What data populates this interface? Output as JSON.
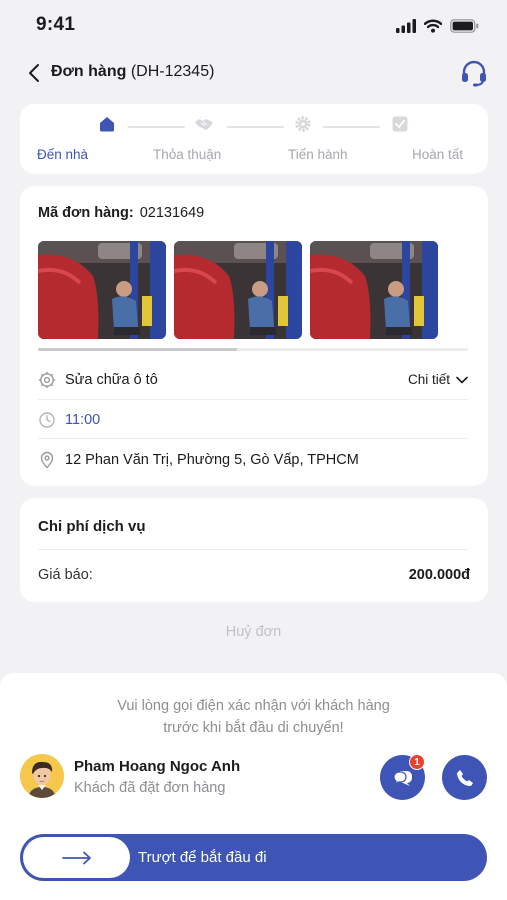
{
  "status_bar": {
    "time": "9:41"
  },
  "header": {
    "title": "Đơn hàng",
    "order_ref": "(DH-12345)"
  },
  "steps": [
    {
      "label": "Đến nhà",
      "active": true,
      "icon": "house-icon"
    },
    {
      "label": "Thỏa thuận",
      "active": false,
      "icon": "handshake-icon"
    },
    {
      "label": "Tiến hành",
      "active": false,
      "icon": "gear-icon"
    },
    {
      "label": "Hoàn tất",
      "active": false,
      "icon": "checkbox-icon"
    }
  ],
  "order": {
    "code_label": "Mã đơn hàng:",
    "code_value": "02131649",
    "service": "Sửa chữa ô tô",
    "detail_label": "Chi tiết",
    "time": "11:00",
    "address": "12 Phan Văn Trị, Phường 5, Gò Vấp, TPHCM"
  },
  "cost": {
    "title": "Chi phí dịch vụ",
    "quote_label": "Giá báo:",
    "quote_value": "200.000đ"
  },
  "cancel_label": "Huỷ đơn",
  "sheet": {
    "notice_line1": "Vui lòng gọi điện xác nhận với khách hàng",
    "notice_line2": "trước khi bắt đầu di chuyển!",
    "customer_name": "Pham Hoang Ngoc Anh",
    "customer_status": "Khách đã đặt đơn hàng",
    "chat_badge": "1",
    "slider_label": "Trượt để bắt đầu đi"
  },
  "colors": {
    "accent": "#3e55b5",
    "badge": "#e8412e",
    "background": "#f2f2f4"
  }
}
